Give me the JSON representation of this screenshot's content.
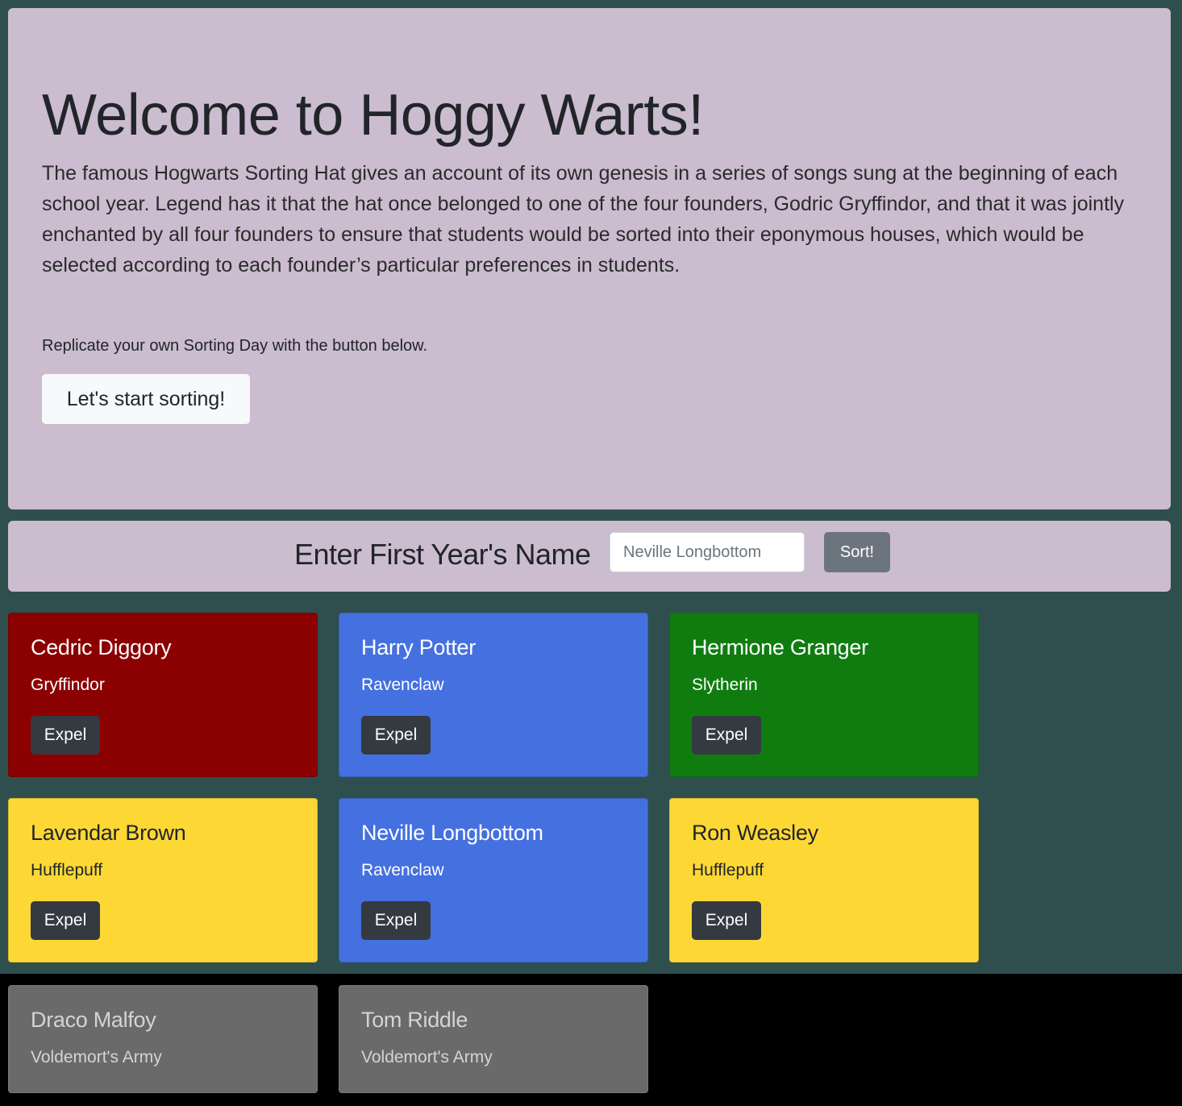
{
  "jumbotron": {
    "title": "Welcome to Hoggy Warts!",
    "lead": "The famous Hogwarts Sorting Hat gives an account of its own genesis in a series of songs sung at the beginning of each school year. Legend has it that the hat once belonged to one of the four founders, Godric Gryffindor, and that it was jointly enchanted by all four founders to ensure that students would be sorted into their eponymous houses, which would be selected according to each founder’s particular preferences in students.",
    "hint": "Replicate your own Sorting Day with the button below.",
    "start_button": "Let's start sorting!"
  },
  "form": {
    "label": "Enter First Year's Name",
    "placeholder": "Neville Longbottom",
    "sort_button": "Sort!"
  },
  "students": [
    {
      "name": "Cedric Diggory",
      "house": "Gryffindor",
      "expel_label": "Expel",
      "color": "#8b0000"
    },
    {
      "name": "Harry Potter",
      "house": "Ravenclaw",
      "expel_label": "Expel",
      "color": "#4570e0"
    },
    {
      "name": "Hermione Granger",
      "house": "Slytherin",
      "expel_label": "Expel",
      "color": "#107c10"
    },
    {
      "name": "Lavendar Brown",
      "house": "Hufflepuff",
      "expel_label": "Expel",
      "color": "#fdd835"
    },
    {
      "name": "Neville Longbottom",
      "house": "Ravenclaw",
      "expel_label": "Expel",
      "color": "#4570e0"
    },
    {
      "name": "Ron Weasley",
      "house": "Hufflepuff",
      "expel_label": "Expel",
      "color": "#fdd835"
    }
  ],
  "army": [
    {
      "name": "Draco Malfoy",
      "house": "Voldemort's Army"
    },
    {
      "name": "Tom Riddle",
      "house": "Voldemort's Army"
    }
  ]
}
